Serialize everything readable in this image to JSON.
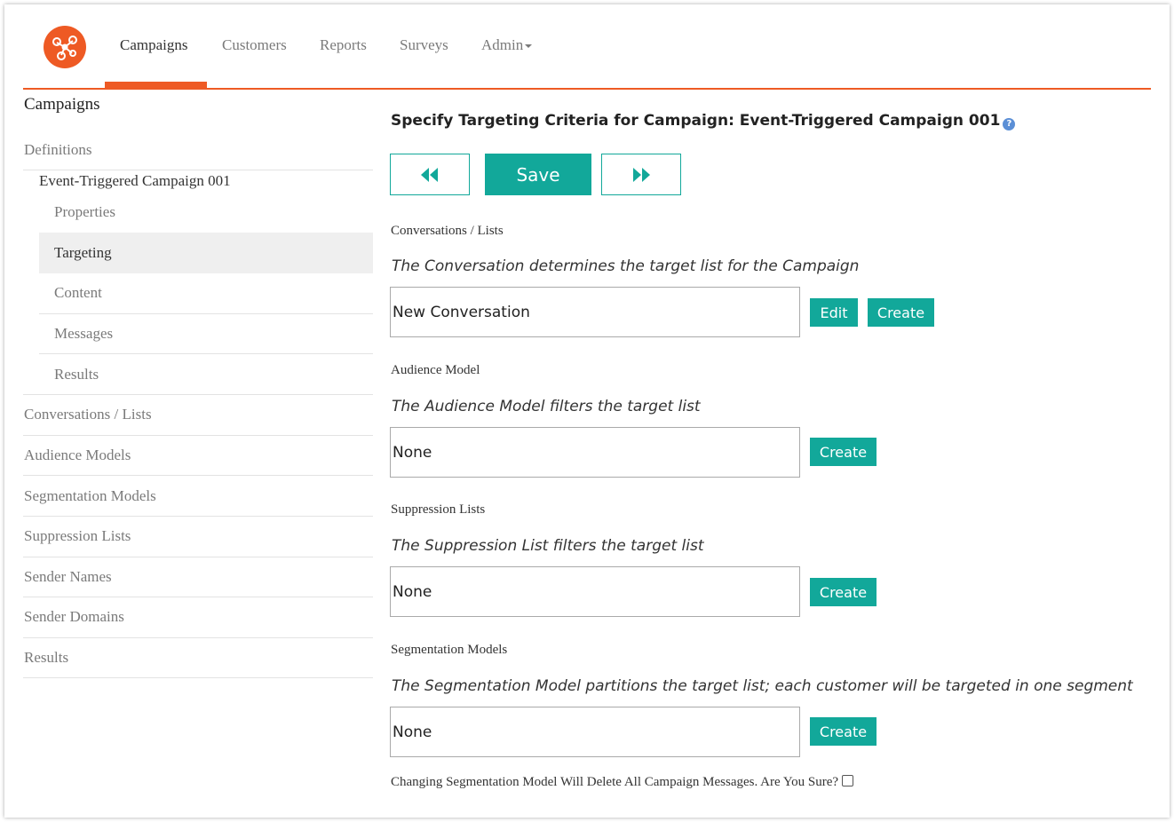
{
  "nav": {
    "items": [
      {
        "label": "Campaigns",
        "active": true
      },
      {
        "label": "Customers"
      },
      {
        "label": "Reports"
      },
      {
        "label": "Surveys"
      },
      {
        "label": "Admin"
      }
    ]
  },
  "sidebar": {
    "title": "Campaigns",
    "definitions": "Definitions",
    "campaign": "Event-Triggered Campaign 001",
    "sub_items": [
      "Properties",
      "Targeting",
      "Content",
      "Messages",
      "Results"
    ],
    "items": [
      "Conversations / Lists",
      "Audience Models",
      "Segmentation Models",
      "Suppression Lists",
      "Sender Names",
      "Sender Domains",
      "Results"
    ]
  },
  "main": {
    "title": "Specify Targeting Criteria for Campaign: Event-Triggered Campaign 001",
    "help_icon": "?",
    "save_label": "Save",
    "sections": {
      "conversations": {
        "label": "Conversations / Lists",
        "description": "The Conversation determines the target list for the Campaign",
        "value": "New Conversation",
        "edit_label": "Edit",
        "create_label": "Create"
      },
      "audience": {
        "label": "Audience Model",
        "description": "The Audience Model filters the target list",
        "value": "None",
        "create_label": "Create"
      },
      "suppression": {
        "label": "Suppression Lists",
        "description": "The Suppression List filters the target list",
        "value": "None",
        "create_label": "Create"
      },
      "segmentation": {
        "label": "Segmentation Models",
        "description": "The Segmentation Model partitions the target list; each customer will be targeted in one segment",
        "value": "None",
        "create_label": "Create"
      }
    },
    "warning": "Changing Segmentation Model Will Delete All Campaign Messages. Are You Sure?"
  },
  "colors": {
    "accent": "#ee5a24",
    "teal": "#12a89a"
  },
  "icons": {
    "logo": "network-logo-icon",
    "prev": "rewind-icon",
    "next": "fast-forward-icon",
    "help": "help-icon"
  }
}
